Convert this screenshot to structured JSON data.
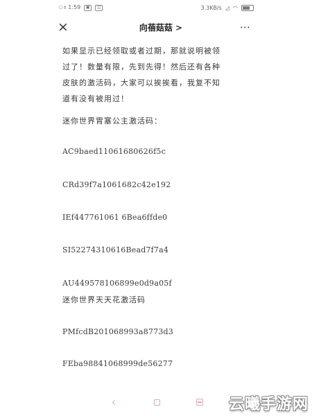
{
  "status_bar": {
    "time": "ঃ 1:59",
    "right_text": "3.3KB/s",
    "icons": [
      "signal-icon",
      "wifi-icon",
      "battery-icon"
    ]
  },
  "header": {
    "close_label": "×",
    "title": "向蓓菇菇 >",
    "more_label": "⋯"
  },
  "article": {
    "intro_lines": [
      "如果显示已经领取或者过期，那就说明被领",
      "过了！数量有限，先到先得！然后还有各种",
      "皮肤的激活码，大家可以挨挨看，我复不知",
      "道有没有被用过！"
    ],
    "heading_1": "迷你世界胃塞公主激活码：",
    "codes_1": [
      "AC9baed11061680626f5c",
      "CRd39f7a1061682c42e192",
      "IEf447761061 6Bea6ffde0",
      "SI52274310616Bead7f7a4",
      "AU449578106899e0d9a05f"
    ],
    "heading_2": "迷你世界天天花激活码",
    "codes_2": [
      "PMfcdB201068993a8773d3",
      "FEba98841068999de56277"
    ]
  },
  "bottom_nav": {
    "back_icon": "back-icon",
    "home_icon": "home-icon",
    "menu_icon": "menu-icon"
  },
  "watermark": {
    "text": "云曦手游网"
  }
}
